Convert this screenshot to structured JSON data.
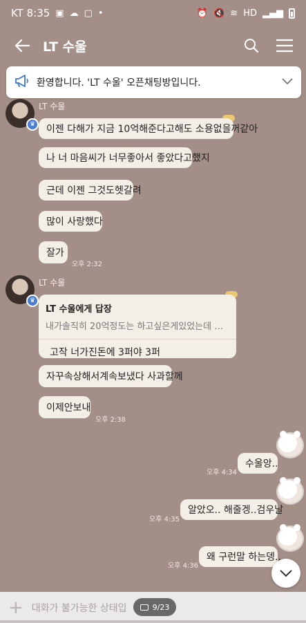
{
  "status_bar": {
    "carrier_time": "KT 8:35",
    "left_icons": [
      "image-icon",
      "cloud-icon",
      "messenger-icon",
      "dot-icon"
    ],
    "right_icons": [
      "alarm-icon",
      "mute-icon",
      "wifi-icon",
      "hd-icon",
      "signal-icon",
      "battery-icon"
    ],
    "hd_label": "HD"
  },
  "header": {
    "title": "LT 수울",
    "icons": [
      "back-arrow-icon",
      "search-icon",
      "menu-icon"
    ]
  },
  "notice": {
    "text": "환영합니다. 'LT 수울' 오픈채팅방입니다.",
    "icon": "megaphone-icon"
  },
  "messages": {
    "group1": {
      "sender": "LT 수울",
      "bubbles": [
        "이젠 다해가 지금 10억해준다고해도 소용없을꺼같아",
        "나 너 마음씨가 너무좋아서 좋았다고했지",
        "근데 이젠 그것도헷갈려",
        "많이 사랑했다",
        "잘가"
      ],
      "time": "오후 2:32"
    },
    "group2": {
      "sender": "LT 수울",
      "reply": {
        "title": "LT 수울에게 답장",
        "quote": "내가솔직히 20억정도는 하고싶은게있었는데 그중 다...",
        "body": "고작 너가진돈에 3퍼야 3퍼"
      },
      "bubbles": [
        "자꾸속상해서계속보냈다 사과할께",
        "이제안보내"
      ],
      "time": "오후 2:38"
    },
    "mine": [
      {
        "text": "수울앙..",
        "time": "오후 4:34"
      },
      {
        "text": "알았오..  해줄겡..검우날",
        "time": "오후 4:35"
      },
      {
        "text": "왜 구런말 하는뎅..",
        "time": "오후 4:36"
      }
    ]
  },
  "input": {
    "placeholder": "대화가 불가능한 상태입"
  },
  "page_indicator": "9/23"
}
